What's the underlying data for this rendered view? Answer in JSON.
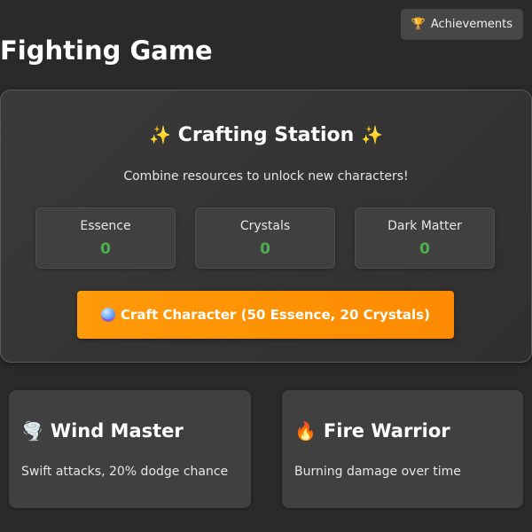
{
  "header": {
    "achievements_label": "Achievements",
    "achievements_icon": "trophy-icon"
  },
  "page": {
    "title": "Fighting Game"
  },
  "crafting": {
    "title": "Crafting Station",
    "title_icon": "sparkles-icon",
    "subtitle": "Combine resources to unlock new characters!",
    "resources": [
      {
        "label": "Essence",
        "value": "0"
      },
      {
        "label": "Crystals",
        "value": "0"
      },
      {
        "label": "Dark Matter",
        "value": "0"
      }
    ],
    "craft_button": {
      "label": "Craft Character (50 Essence, 20 Crystals)",
      "icon": "crystal-ball-icon"
    }
  },
  "characters": [
    {
      "name": "Wind Master",
      "description": "Swift attacks, 20% dodge chance",
      "icon": "tornado-icon"
    },
    {
      "name": "Fire Warrior",
      "description": "Burning damage over time",
      "icon": "fire-icon"
    }
  ],
  "colors": {
    "background": "#2a2a2a",
    "panel": "#404040",
    "accent_orange": "#ff9a0a",
    "resource_value_green": "#4caf50",
    "sparkle": "#f5d35a"
  }
}
